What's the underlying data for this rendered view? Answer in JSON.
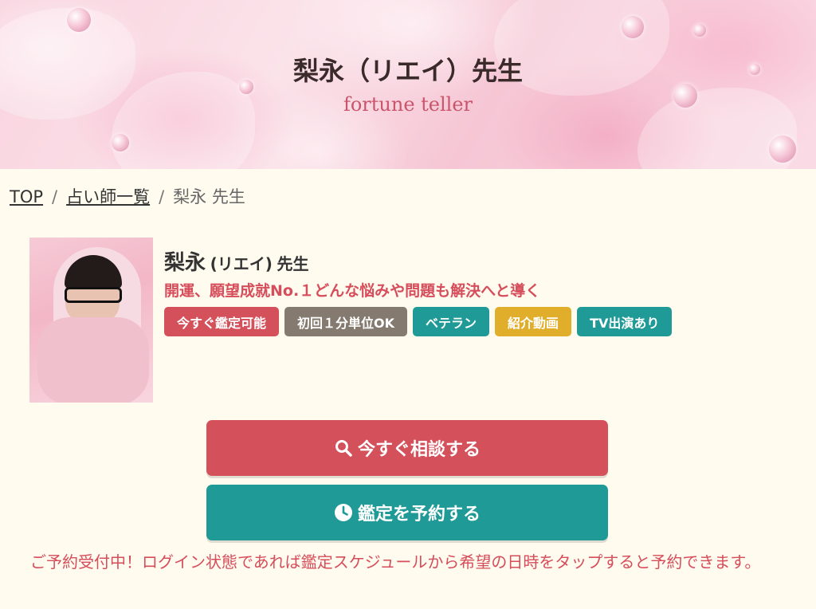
{
  "header": {
    "title": "梨永（リエイ）先生",
    "subtitle": "fortune teller"
  },
  "breadcrumb": {
    "items": [
      {
        "label": "TOP",
        "link": true
      },
      {
        "label": "占い師一覧",
        "link": true
      },
      {
        "label": "梨永 先生",
        "link": false
      }
    ],
    "separator": "/"
  },
  "profile": {
    "name": "梨永",
    "reading": "(リエイ)",
    "honorific": "先生",
    "tagline": "開運、願望成就No.１どんな悩みや問題も解決へと導く",
    "badges": [
      {
        "label": "今すぐ鑑定可能",
        "color": "#d4505b"
      },
      {
        "label": "初回１分単位OK",
        "color": "#857a70"
      },
      {
        "label": "ベテラン",
        "color": "#1f9a96"
      },
      {
        "label": "紹介動画",
        "color": "#e0ae2a"
      },
      {
        "label": "TV出演あり",
        "color": "#1f9a96"
      }
    ]
  },
  "actions": {
    "consult_label": "今すぐ相談する",
    "consult_icon": "search-icon",
    "reserve_label": "鑑定を予約する",
    "reserve_icon": "clock-icon"
  },
  "notice": "ご予約受付中！ログイン状態であれば鑑定スケジュールから希望の日時をタップすると予約できます。",
  "colors": {
    "accent_red": "#d4505b",
    "accent_teal": "#1f9a96",
    "page_bg": "#fffbee",
    "subtitle_pink": "#c9556b"
  }
}
